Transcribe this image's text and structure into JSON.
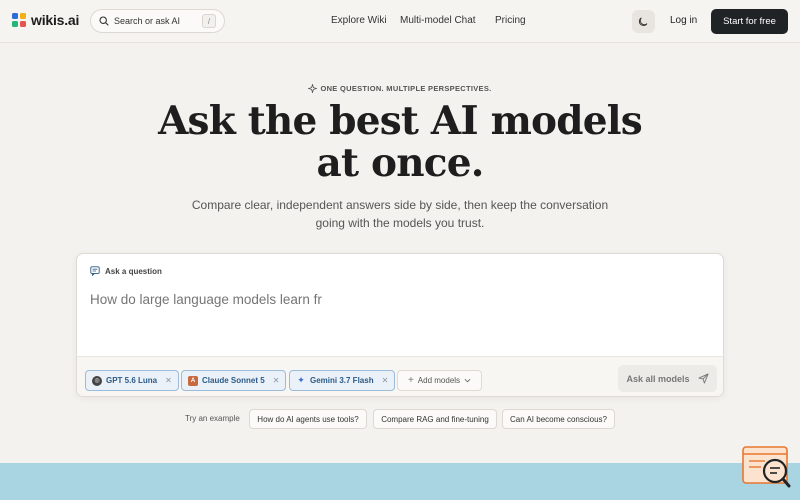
{
  "brand": {
    "name": "wikis.ai",
    "colors": [
      "#2f6ad9",
      "#f2b019",
      "#27b67a",
      "#e5554f"
    ]
  },
  "search": {
    "label": "Search or ask AI",
    "shortcut": "/"
  },
  "nav": {
    "items": [
      "Explore Wiki",
      "Multi-model Chat",
      "Pricing"
    ]
  },
  "header": {
    "theme_icon": "moon-icon",
    "login": "Log in",
    "cta": "Start for free"
  },
  "hero": {
    "eyebrow": "ONE QUESTION. MULTIPLE PERSPECTIVES.",
    "headline": "Ask the best AI models at once.",
    "subtitle": "Compare clear, independent answers side by side, then keep the conversation going with the models you trust."
  },
  "ask": {
    "label": "Ask a question",
    "placeholder": "How do large language models learn fr",
    "models": [
      {
        "name": "GPT 5.6 Luna",
        "icon": "openai-icon"
      },
      {
        "name": "Claude Sonnet 5",
        "icon": "anthropic-icon"
      },
      {
        "name": "Gemini 3.7 Flash",
        "icon": "gemini-icon"
      }
    ],
    "add_models": "Add models",
    "submit": "Ask all models"
  },
  "examples": {
    "label": "Try an example",
    "items": [
      "How do AI agents use tools?",
      "Compare RAG and fine-tuning",
      "Can AI become conscious?"
    ]
  },
  "colors": {
    "cta_bg": "#1f2326",
    "chip_border": "#9cbbd8",
    "chip_text": "#2c5a86",
    "band": "#a9d5e3"
  }
}
